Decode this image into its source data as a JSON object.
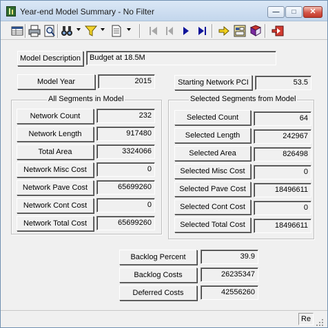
{
  "window": {
    "title": "Year-end Model Summary - No Filter"
  },
  "titlebar_buttons": {
    "minimize": "—",
    "maximize": "□",
    "close": "✕"
  },
  "toolbar": {
    "icons": [
      "grid-icon",
      "print-icon",
      "print-preview-icon",
      "binoculars-icon",
      "filter-icon",
      "document-icon",
      "first-record-icon",
      "previous-record-icon",
      "next-record-icon",
      "last-record-icon",
      "arrow-icon",
      "report-icon",
      "book-icon",
      "exit-icon"
    ]
  },
  "model": {
    "description_label": "Model Description",
    "description_value": "Budget at 18.5M",
    "year_label": "Model Year",
    "year_value": "2015",
    "starting_pci_label": "Starting Network PCI",
    "starting_pci_value": "53.5"
  },
  "all_segments": {
    "title": "All Segments in Model",
    "rows": [
      {
        "label": "Network Count",
        "value": "232"
      },
      {
        "label": "Network Length",
        "value": "917480"
      },
      {
        "label": "Total Area",
        "value": "3324066"
      },
      {
        "label": "Network Misc Cost",
        "value": "0"
      },
      {
        "label": "Network Pave Cost",
        "value": "65699260"
      },
      {
        "label": "Network Cont Cost",
        "value": "0"
      },
      {
        "label": "Network Total Cost",
        "value": "65699260"
      }
    ]
  },
  "selected_segments": {
    "title": "Selected Segments from Model",
    "rows": [
      {
        "label": "Selected Count",
        "value": "64"
      },
      {
        "label": "Selected Length",
        "value": "242967"
      },
      {
        "label": "Selected Area",
        "value": "826498"
      },
      {
        "label": "Selected Misc Cost",
        "value": "0"
      },
      {
        "label": "Selected Pave Cost",
        "value": "18496611"
      },
      {
        "label": "Selected Cont Cost",
        "value": "0"
      },
      {
        "label": "Selected Total Cost",
        "value": "18496611"
      }
    ]
  },
  "backlog": {
    "rows": [
      {
        "label": "Backlog Percent",
        "value": "39.9"
      },
      {
        "label": "Backlog Costs",
        "value": "26235347"
      },
      {
        "label": "Deferred Costs",
        "value": "42556260"
      }
    ]
  },
  "statusbar": {
    "text": "Re"
  }
}
